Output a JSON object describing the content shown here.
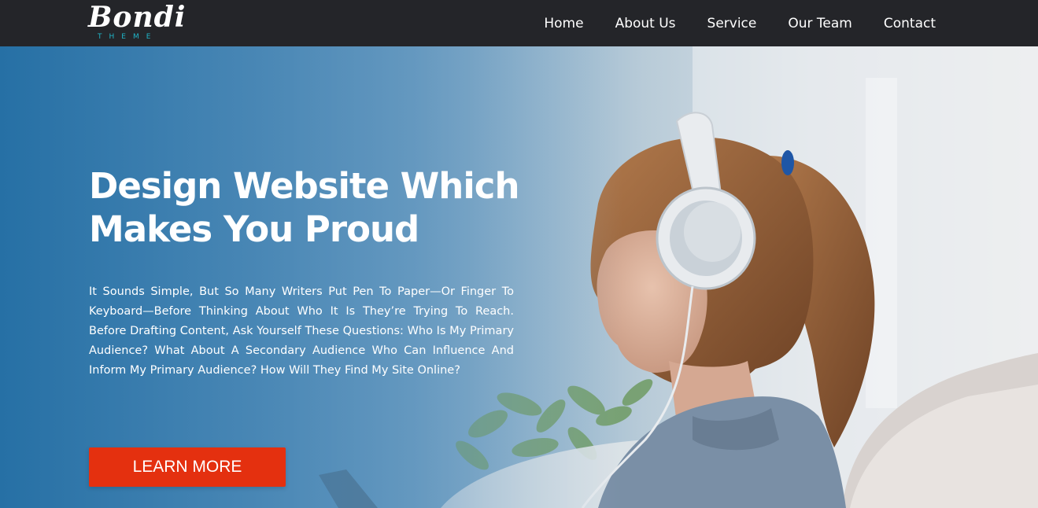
{
  "brand": {
    "name": "Bondi",
    "tagline": "THEME",
    "accent": "#1fb6c9"
  },
  "nav": {
    "items": [
      "Home",
      "About Us",
      "Service",
      "Our Team",
      "Contact"
    ]
  },
  "hero": {
    "title_line1": "Design Website Which",
    "title_line2": "Makes You Proud",
    "body": "It Sounds Simple, But So Many Writers Put Pen To Paper—Or Finger To Keyboard—Before Thinking About Who It Is They’re Trying To Reach. Before Drafting Content, Ask Yourself These Questions: Who Is My Primary Audience? What About A Secondary Audience Who Can Influence And Inform My Primary Audience? How Will They Find My Site Online?",
    "cta_label": "LEARN MORE",
    "cta_color": "#e4300f"
  },
  "colors": {
    "navbar_bg": "#242529",
    "hero_blue": "#2670a5"
  }
}
